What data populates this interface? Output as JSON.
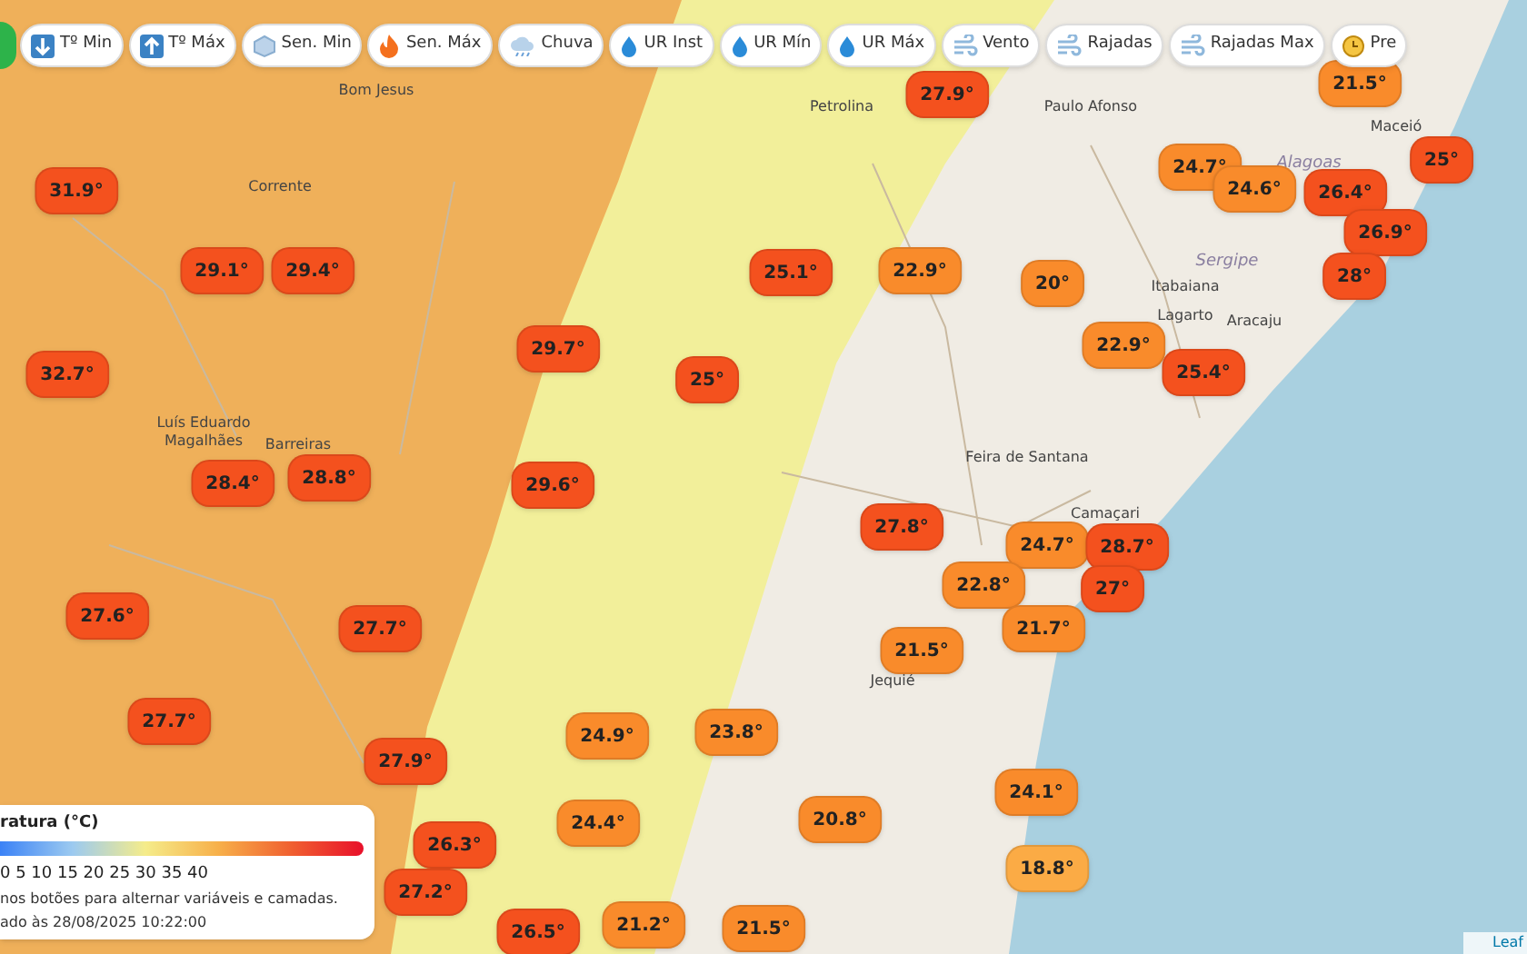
{
  "toolbar": {
    "buttons": [
      {
        "label": "Tº Min"
      },
      {
        "label": "Tº Máx"
      },
      {
        "label": "Sen. Min"
      },
      {
        "label": "Sen. Máx"
      },
      {
        "label": "Chuva"
      },
      {
        "label": "UR Inst"
      },
      {
        "label": "UR Mín"
      },
      {
        "label": "UR Máx"
      },
      {
        "label": "Vento"
      },
      {
        "label": "Rajadas"
      },
      {
        "label": "Rajadas Max"
      },
      {
        "label": "Pre"
      }
    ]
  },
  "map": {
    "places": [
      {
        "label": "Bom Jesus",
        "kind": "city"
      },
      {
        "label": "Petrolina",
        "kind": "city"
      },
      {
        "label": "Paulo Afonso",
        "kind": "city"
      },
      {
        "label": "Corrente",
        "kind": "city"
      },
      {
        "label": "Luís Eduardo Magalhães",
        "kind": "city"
      },
      {
        "label": "Barreiras",
        "kind": "city"
      },
      {
        "label": "Alagoas",
        "kind": "state"
      },
      {
        "label": "Maceió",
        "kind": "city"
      },
      {
        "label": "Sergipe",
        "kind": "state"
      },
      {
        "label": "Itabaiana",
        "kind": "city"
      },
      {
        "label": "Lagarto",
        "kind": "city"
      },
      {
        "label": "Aracaju",
        "kind": "city"
      },
      {
        "label": "Feira de Santana",
        "kind": "city"
      },
      {
        "label": "Camaçari",
        "kind": "city"
      },
      {
        "label": "Jequié",
        "kind": "city"
      }
    ],
    "markers": [
      {
        "value": "31.9°",
        "color": "#f4511e"
      },
      {
        "value": "29.1°",
        "color": "#f4511e"
      },
      {
        "value": "29.4°",
        "color": "#f4511e"
      },
      {
        "value": "32.7°",
        "color": "#f4511e"
      },
      {
        "value": "28.4°",
        "color": "#f4511e"
      },
      {
        "value": "28.8°",
        "color": "#f4511e"
      },
      {
        "value": "27.6°",
        "color": "#f4511e"
      },
      {
        "value": "27.7°",
        "color": "#f4511e"
      },
      {
        "value": "27.7°",
        "color": "#f4511e"
      },
      {
        "value": "27.9°",
        "color": "#f4511e"
      },
      {
        "value": "26.3°",
        "color": "#f4511e"
      },
      {
        "value": "27.2°",
        "color": "#f4511e"
      },
      {
        "value": "26.5°",
        "color": "#f4511e"
      },
      {
        "value": "21.2°",
        "color": "#f98b2b"
      },
      {
        "value": "21.5°",
        "color": "#f98b2b"
      },
      {
        "value": "24.4°",
        "color": "#f98b2b"
      },
      {
        "value": "24.9°",
        "color": "#f98b2b"
      },
      {
        "value": "23.8°",
        "color": "#f98b2b"
      },
      {
        "value": "20.8°",
        "color": "#f98b2b"
      },
      {
        "value": "29.7°",
        "color": "#f4511e"
      },
      {
        "value": "29.6°",
        "color": "#f4511e"
      },
      {
        "value": "25.1°",
        "color": "#f4511e"
      },
      {
        "value": "25°",
        "color": "#f4511e"
      },
      {
        "value": "27.9°",
        "color": "#f4511e"
      },
      {
        "value": "22.9°",
        "color": "#f98b2b"
      },
      {
        "value": "20°",
        "color": "#f98b2b"
      },
      {
        "value": "22.9°",
        "color": "#f98b2b"
      },
      {
        "value": "25.4°",
        "color": "#f4511e"
      },
      {
        "value": "21.5°",
        "color": "#f98b2b"
      },
      {
        "value": "24.7°",
        "color": "#f98b2b"
      },
      {
        "value": "24.6°",
        "color": "#f98b2b"
      },
      {
        "value": "26.4°",
        "color": "#f4511e"
      },
      {
        "value": "25°",
        "color": "#f4511e"
      },
      {
        "value": "26.9°",
        "color": "#f4511e"
      },
      {
        "value": "28°",
        "color": "#f4511e"
      },
      {
        "value": "27.8°",
        "color": "#f4511e"
      },
      {
        "value": "24.7°",
        "color": "#f98b2b"
      },
      {
        "value": "28.7°",
        "color": "#f4511e"
      },
      {
        "value": "27°",
        "color": "#f4511e"
      },
      {
        "value": "22.8°",
        "color": "#f98b2b"
      },
      {
        "value": "21.7°",
        "color": "#f98b2b"
      },
      {
        "value": "21.5°",
        "color": "#f98b2b"
      },
      {
        "value": "24.1°",
        "color": "#f98b2b"
      },
      {
        "value": "18.8°",
        "color": "#fbab45"
      }
    ],
    "attribution": "Leaf"
  },
  "legend": {
    "title": "ratura (°C)",
    "scale": "0 5 10 15 20 25 30 35 40",
    "hint": "nos botões para alternar variáveis e camadas.",
    "updated": "ado às 28/08/2025 10:22:00"
  }
}
